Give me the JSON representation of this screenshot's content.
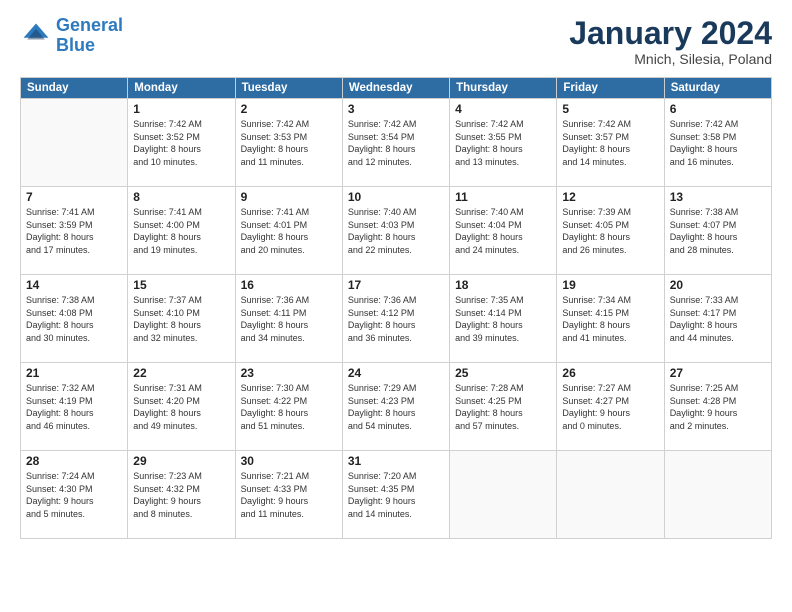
{
  "header": {
    "logo_line1": "General",
    "logo_line2": "Blue",
    "title": "January 2024",
    "location": "Mnich, Silesia, Poland"
  },
  "weekdays": [
    "Sunday",
    "Monday",
    "Tuesday",
    "Wednesday",
    "Thursday",
    "Friday",
    "Saturday"
  ],
  "weeks": [
    [
      {
        "day": "",
        "info": ""
      },
      {
        "day": "1",
        "info": "Sunrise: 7:42 AM\nSunset: 3:52 PM\nDaylight: 8 hours\nand 10 minutes."
      },
      {
        "day": "2",
        "info": "Sunrise: 7:42 AM\nSunset: 3:53 PM\nDaylight: 8 hours\nand 11 minutes."
      },
      {
        "day": "3",
        "info": "Sunrise: 7:42 AM\nSunset: 3:54 PM\nDaylight: 8 hours\nand 12 minutes."
      },
      {
        "day": "4",
        "info": "Sunrise: 7:42 AM\nSunset: 3:55 PM\nDaylight: 8 hours\nand 13 minutes."
      },
      {
        "day": "5",
        "info": "Sunrise: 7:42 AM\nSunset: 3:57 PM\nDaylight: 8 hours\nand 14 minutes."
      },
      {
        "day": "6",
        "info": "Sunrise: 7:42 AM\nSunset: 3:58 PM\nDaylight: 8 hours\nand 16 minutes."
      }
    ],
    [
      {
        "day": "7",
        "info": "Sunrise: 7:41 AM\nSunset: 3:59 PM\nDaylight: 8 hours\nand 17 minutes."
      },
      {
        "day": "8",
        "info": "Sunrise: 7:41 AM\nSunset: 4:00 PM\nDaylight: 8 hours\nand 19 minutes."
      },
      {
        "day": "9",
        "info": "Sunrise: 7:41 AM\nSunset: 4:01 PM\nDaylight: 8 hours\nand 20 minutes."
      },
      {
        "day": "10",
        "info": "Sunrise: 7:40 AM\nSunset: 4:03 PM\nDaylight: 8 hours\nand 22 minutes."
      },
      {
        "day": "11",
        "info": "Sunrise: 7:40 AM\nSunset: 4:04 PM\nDaylight: 8 hours\nand 24 minutes."
      },
      {
        "day": "12",
        "info": "Sunrise: 7:39 AM\nSunset: 4:05 PM\nDaylight: 8 hours\nand 26 minutes."
      },
      {
        "day": "13",
        "info": "Sunrise: 7:38 AM\nSunset: 4:07 PM\nDaylight: 8 hours\nand 28 minutes."
      }
    ],
    [
      {
        "day": "14",
        "info": "Sunrise: 7:38 AM\nSunset: 4:08 PM\nDaylight: 8 hours\nand 30 minutes."
      },
      {
        "day": "15",
        "info": "Sunrise: 7:37 AM\nSunset: 4:10 PM\nDaylight: 8 hours\nand 32 minutes."
      },
      {
        "day": "16",
        "info": "Sunrise: 7:36 AM\nSunset: 4:11 PM\nDaylight: 8 hours\nand 34 minutes."
      },
      {
        "day": "17",
        "info": "Sunrise: 7:36 AM\nSunset: 4:12 PM\nDaylight: 8 hours\nand 36 minutes."
      },
      {
        "day": "18",
        "info": "Sunrise: 7:35 AM\nSunset: 4:14 PM\nDaylight: 8 hours\nand 39 minutes."
      },
      {
        "day": "19",
        "info": "Sunrise: 7:34 AM\nSunset: 4:15 PM\nDaylight: 8 hours\nand 41 minutes."
      },
      {
        "day": "20",
        "info": "Sunrise: 7:33 AM\nSunset: 4:17 PM\nDaylight: 8 hours\nand 44 minutes."
      }
    ],
    [
      {
        "day": "21",
        "info": "Sunrise: 7:32 AM\nSunset: 4:19 PM\nDaylight: 8 hours\nand 46 minutes."
      },
      {
        "day": "22",
        "info": "Sunrise: 7:31 AM\nSunset: 4:20 PM\nDaylight: 8 hours\nand 49 minutes."
      },
      {
        "day": "23",
        "info": "Sunrise: 7:30 AM\nSunset: 4:22 PM\nDaylight: 8 hours\nand 51 minutes."
      },
      {
        "day": "24",
        "info": "Sunrise: 7:29 AM\nSunset: 4:23 PM\nDaylight: 8 hours\nand 54 minutes."
      },
      {
        "day": "25",
        "info": "Sunrise: 7:28 AM\nSunset: 4:25 PM\nDaylight: 8 hours\nand 57 minutes."
      },
      {
        "day": "26",
        "info": "Sunrise: 7:27 AM\nSunset: 4:27 PM\nDaylight: 9 hours\nand 0 minutes."
      },
      {
        "day": "27",
        "info": "Sunrise: 7:25 AM\nSunset: 4:28 PM\nDaylight: 9 hours\nand 2 minutes."
      }
    ],
    [
      {
        "day": "28",
        "info": "Sunrise: 7:24 AM\nSunset: 4:30 PM\nDaylight: 9 hours\nand 5 minutes."
      },
      {
        "day": "29",
        "info": "Sunrise: 7:23 AM\nSunset: 4:32 PM\nDaylight: 9 hours\nand 8 minutes."
      },
      {
        "day": "30",
        "info": "Sunrise: 7:21 AM\nSunset: 4:33 PM\nDaylight: 9 hours\nand 11 minutes."
      },
      {
        "day": "31",
        "info": "Sunrise: 7:20 AM\nSunset: 4:35 PM\nDaylight: 9 hours\nand 14 minutes."
      },
      {
        "day": "",
        "info": ""
      },
      {
        "day": "",
        "info": ""
      },
      {
        "day": "",
        "info": ""
      }
    ]
  ]
}
